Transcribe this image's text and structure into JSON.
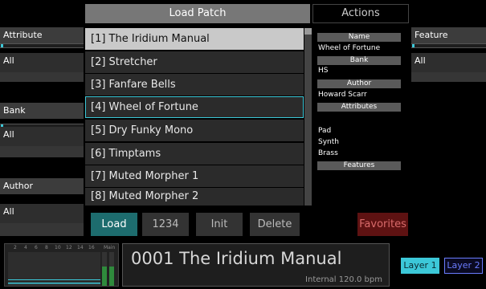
{
  "header": {
    "load_patch": "Load Patch",
    "actions": "Actions"
  },
  "left_filters": [
    {
      "label": "Attribute",
      "value": "All"
    },
    {
      "label": "Bank",
      "value": "All"
    },
    {
      "label": "Author",
      "value": "All"
    }
  ],
  "right_filter": {
    "label": "Feature",
    "value": "All"
  },
  "patches": [
    "[1] The Iridium Manual",
    "[2] Stretcher",
    "[3] Fanfare Bells",
    "[4] Wheel of Fortune",
    "[5] Dry Funky Mono",
    "[6] Timptams",
    "[7] Muted Morpher 1",
    "[8] Muted Morpher 2"
  ],
  "info": {
    "name_label": "Name",
    "name_value": "Wheel of Fortune",
    "bank_label": "Bank",
    "bank_value": "HS",
    "author_label": "Author",
    "author_value": "Howard Scarr",
    "attributes_label": "Attributes",
    "attributes": [
      "Pad",
      "Synth",
      "Brass"
    ],
    "features_label": "Features"
  },
  "buttons": {
    "load": "Load",
    "number": "1234",
    "init": "Init",
    "delete": "Delete",
    "favorites": "Favorites"
  },
  "meter_labels": [
    "2",
    "4",
    "6",
    "8",
    "10",
    "12",
    "14",
    "16",
    "Main"
  ],
  "display": {
    "patch": "0001 The Iridium Manual",
    "status": "Internal 120.0 bpm"
  },
  "layers": {
    "layer1": "Layer 1",
    "layer2": "Layer 2"
  },
  "colors": {
    "accent": "#3cc8d8",
    "load": "#1d6c6e",
    "favorites": "#5e1212"
  }
}
